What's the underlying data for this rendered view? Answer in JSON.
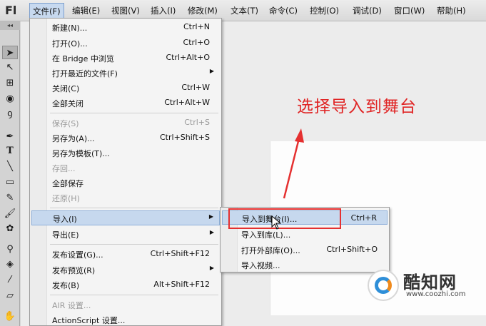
{
  "app": {
    "logo": "Fl"
  },
  "menubar": {
    "items": [
      "文件(F)",
      "编辑(E)",
      "视图(V)",
      "插入(I)",
      "修改(M)",
      "文本(T)",
      "命令(C)",
      "控制(O)",
      "调试(D)",
      "窗口(W)",
      "帮助(H)"
    ],
    "active_index": 0
  },
  "file_menu": {
    "items": [
      {
        "label": "新建(N)...",
        "shortcut": "Ctrl+N"
      },
      {
        "label": "打开(O)...",
        "shortcut": "Ctrl+O"
      },
      {
        "label": "在 Bridge 中浏览",
        "shortcut": "Ctrl+Alt+O"
      },
      {
        "label": "打开最近的文件(F)",
        "shortcut": ""
      },
      {
        "label": "关闭(C)",
        "shortcut": "Ctrl+W"
      },
      {
        "label": "全部关闭",
        "shortcut": "Ctrl+Alt+W"
      },
      {
        "label": "保存(S)",
        "shortcut": "Ctrl+S"
      },
      {
        "label": "另存为(A)...",
        "shortcut": "Ctrl+Shift+S"
      },
      {
        "label": "另存为模板(T)...",
        "shortcut": ""
      },
      {
        "label": "存回...",
        "shortcut": ""
      },
      {
        "label": "全部保存",
        "shortcut": ""
      },
      {
        "label": "还原(H)",
        "shortcut": ""
      },
      {
        "label": "导入(I)",
        "shortcut": ""
      },
      {
        "label": "导出(E)",
        "shortcut": ""
      },
      {
        "label": "发布设置(G)...",
        "shortcut": "Ctrl+Shift+F12"
      },
      {
        "label": "发布预览(R)",
        "shortcut": ""
      },
      {
        "label": "发布(B)",
        "shortcut": "Alt+Shift+F12"
      },
      {
        "label": "AIR 设置...",
        "shortcut": ""
      },
      {
        "label": "ActionScript 设置...",
        "shortcut": ""
      }
    ]
  },
  "import_submenu": {
    "items": [
      {
        "label": "导入到舞台(I)...",
        "shortcut": "Ctrl+R"
      },
      {
        "label": "导入到库(L)...",
        "shortcut": ""
      },
      {
        "label": "打开外部库(O)...",
        "shortcut": "Ctrl+Shift+O"
      },
      {
        "label": "导入视频...",
        "shortcut": ""
      }
    ]
  },
  "annotation": {
    "text": "选择导入到舞台",
    "color": "#e02424"
  },
  "watermark": {
    "name": "酷知网",
    "url": "www.coozhi.com"
  },
  "colors": {
    "highlight": "#c6d8ee",
    "annotation_red": "#e53030"
  }
}
